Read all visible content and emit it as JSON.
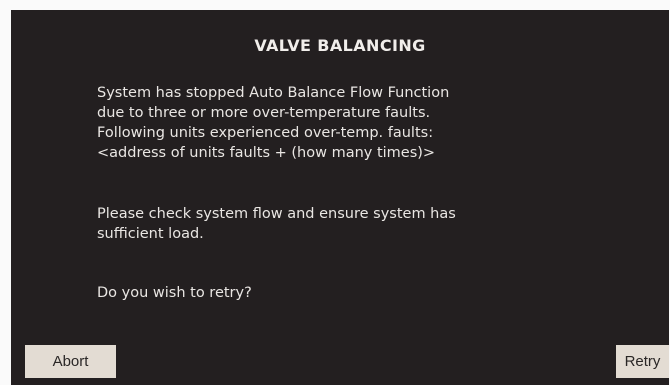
{
  "dialog": {
    "title": "VALVE BALANCING",
    "message": [
      "System has stopped Auto Balance Flow Function",
      "due to three or more over-temperature faults.",
      "Following units experienced over-temp. faults:",
      "<address of units faults + (how many times)>"
    ],
    "check": [
      "Please check system flow and ensure system has",
      "sufficient load."
    ],
    "question": "Do you wish to retry?"
  },
  "buttons": {
    "abort_label": "Abort",
    "retry_label": "Retry"
  }
}
